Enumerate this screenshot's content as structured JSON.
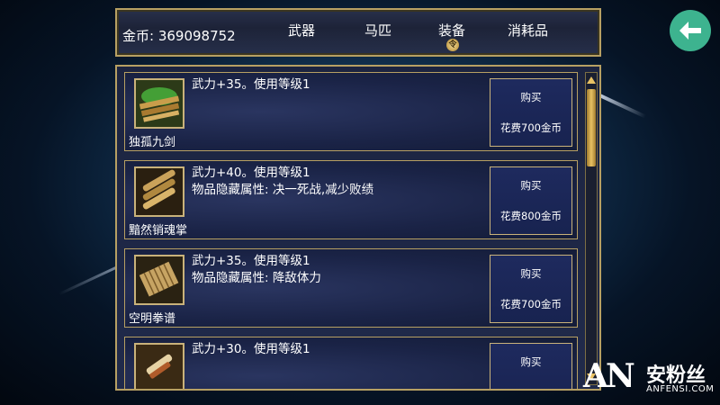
{
  "header": {
    "coins": "金币: 369098752",
    "tabs": [
      {
        "label": "武器"
      },
      {
        "label": "马匹"
      },
      {
        "label": "装备"
      },
      {
        "label": "消耗品"
      }
    ],
    "active_tab_marker": "令"
  },
  "items": [
    {
      "name": "独孤九剑",
      "line1": "武力+35。使用等级1",
      "line2": "",
      "buy": "购买",
      "price": "花费700金币"
    },
    {
      "name": "黯然销魂掌",
      "line1": "武力+40。使用等级1",
      "line2": "物品隐藏属性: 决一死战,减少败绩",
      "buy": "购买",
      "price": "花费800金币"
    },
    {
      "name": "空明拳谱",
      "line1": "武力+35。使用等级1",
      "line2": "物品隐藏属性: 降敌体力",
      "buy": "购买",
      "price": "花费700金币"
    },
    {
      "name": "",
      "line1": "武力+30。使用等级1",
      "line2": "",
      "buy": "购买",
      "price": ""
    }
  ],
  "watermark": {
    "logo": "AN",
    "cn": "安粉丝",
    "en": "ANFENSI.COM"
  },
  "colors": {
    "accent": "#b7a063",
    "panel": "#1c2440",
    "back_button": "#3db38f"
  },
  "icons": {
    "back": "arrow-left-icon"
  }
}
